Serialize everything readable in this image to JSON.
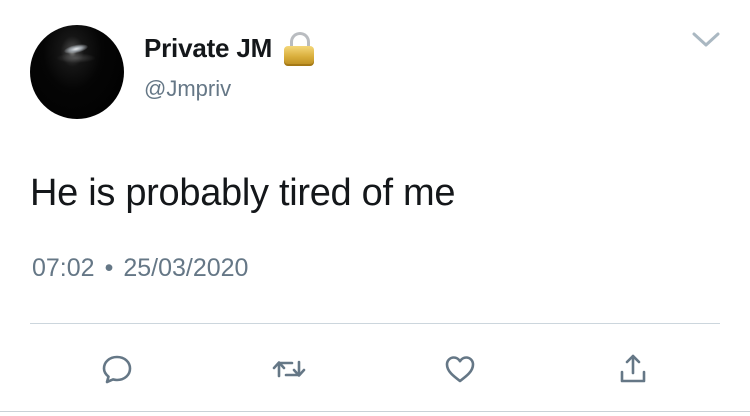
{
  "tweet": {
    "author": {
      "display_name": "Private JM",
      "handle": "@Jmpriv",
      "avatar_icon": "night-moon-avatar",
      "protected_icon": "lock-icon"
    },
    "text": "He is probably tired of me",
    "time": "07:02",
    "separator": "•",
    "date": "25/03/2020",
    "menu_icon": "chevron-down-icon"
  },
  "actions": [
    {
      "icon": "reply-icon"
    },
    {
      "icon": "retweet-icon"
    },
    {
      "icon": "like-icon"
    },
    {
      "icon": "share-icon"
    }
  ],
  "colors": {
    "text": "#14171a",
    "secondary": "#657786",
    "icon": "#657786",
    "divider": "#ccd6dd"
  }
}
